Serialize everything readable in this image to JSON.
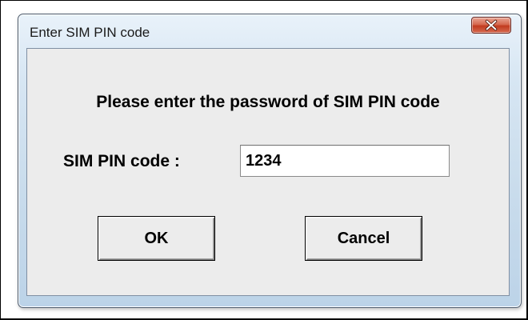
{
  "window": {
    "title": "Enter SIM PIN code",
    "close_icon": "close-x-icon"
  },
  "dialog": {
    "prompt": "Please enter the password of SIM PIN code",
    "pin_label": "SIM PIN code :",
    "pin_value": "1234"
  },
  "buttons": {
    "ok_label": "OK",
    "cancel_label": "Cancel"
  },
  "colors": {
    "close_button": "#c13b1f",
    "client_background": "#ececec",
    "frame": "#c9dcec"
  }
}
